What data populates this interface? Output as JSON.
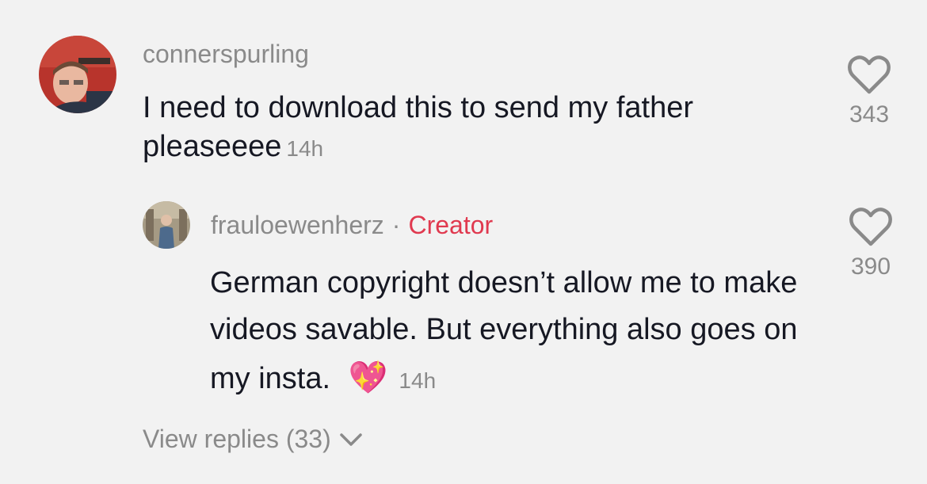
{
  "comment": {
    "username": "connerspurling",
    "text": "I need to download this to send my father pleaseeee",
    "timestamp": "14h",
    "likes": "343"
  },
  "reply": {
    "username": "frauloewenherz",
    "separator": "·",
    "badge": "Creator",
    "text": "German copyright doesn’t allow me to make videos savable. But everything also goes on my insta.",
    "emoji": "💖",
    "timestamp": "14h",
    "likes": "390"
  },
  "view_replies": {
    "label": "View replies (33)"
  },
  "colors": {
    "background": "#f2f2f2",
    "text": "#161823",
    "muted": "#8a8a8a",
    "creator": "#e0394f"
  }
}
